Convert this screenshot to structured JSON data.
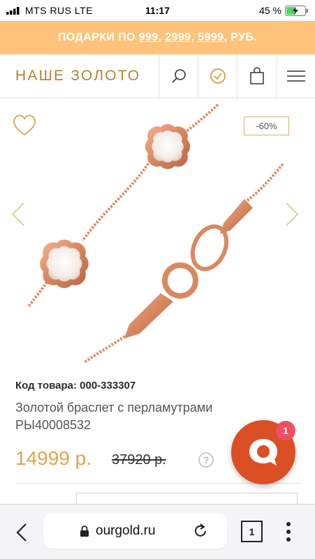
{
  "status_bar": {
    "carrier": "MTS RUS  LTE",
    "time": "11:17",
    "battery": "45 %"
  },
  "promo": {
    "prefix": "ПОДАРКИ ПО ",
    "amounts": [
      "999",
      "2999",
      "5999"
    ],
    "sep1": ", ",
    "sep2": ", ",
    "suffix": ", РУБ."
  },
  "header": {
    "logo": "НАШЕ ЗОЛОТО",
    "icons": [
      "search-icon",
      "check-badge-icon",
      "shopping-bag-icon",
      "menu-icon"
    ]
  },
  "product": {
    "discount_badge": "-60%",
    "code_label": "Код товара: 000-333307",
    "title": "Золотой браслет с перламутрами РЫ40008532",
    "price": "14999 р.",
    "old_price": "37920 р.",
    "help": "?"
  },
  "chat": {
    "badge_count": "1"
  },
  "browser": {
    "url": "ourgold.ru",
    "tab_count": "1"
  },
  "colors": {
    "promo_bg": "#fdc37b",
    "accent_gold": "#b6822e",
    "price": "#e0a24f",
    "chat_button": "#db4f25",
    "chat_badge": "#ef4e63"
  }
}
